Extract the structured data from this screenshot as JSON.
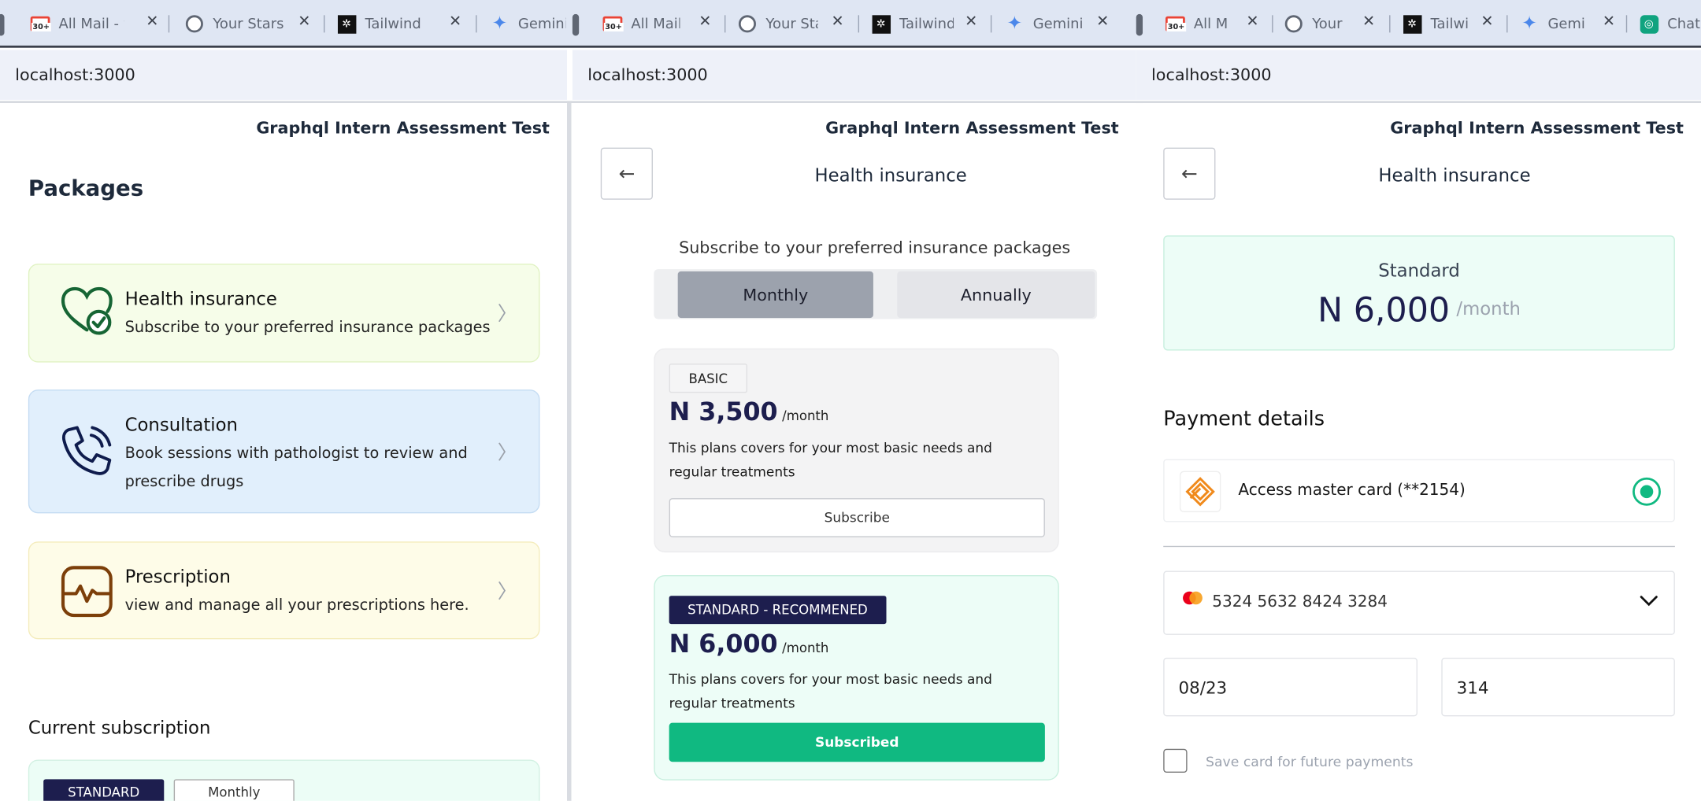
{
  "browser": {
    "tabs": [
      {
        "title": "All Mail - tu",
        "icon": "gmail-icon",
        "group": 1
      },
      {
        "title": "Your Stars",
        "icon": "github-icon",
        "group": 1
      },
      {
        "title": "Tailwind CS",
        "icon": "tailwind-icon",
        "group": 1
      },
      {
        "title": "Gemini",
        "icon": "gemini-icon",
        "group": 1
      },
      {
        "title": "All Mail",
        "icon": "gmail-icon",
        "group": 2
      },
      {
        "title": "Your Sta",
        "icon": "github-icon",
        "group": 2
      },
      {
        "title": "Tailwind",
        "icon": "tailwind-icon",
        "group": 2
      },
      {
        "title": "Gemini",
        "icon": "gemini-icon",
        "group": 2
      },
      {
        "title": "All M",
        "icon": "gmail-icon",
        "group": 3
      },
      {
        "title": "Your",
        "icon": "github-icon",
        "group": 3
      },
      {
        "title": "Tailwi",
        "icon": "tailwind-icon",
        "group": 3
      },
      {
        "title": "Gemi",
        "icon": "gemini-icon",
        "group": 3
      },
      {
        "title": "Chat",
        "icon": "chatgpt-icon",
        "group": 3
      }
    ],
    "gmail_badge": "30+",
    "url": "localhost:3000"
  },
  "site": {
    "header": "Graphql Intern Assessment Test"
  },
  "packages_page": {
    "title": "Packages",
    "cards": [
      {
        "title": "Health insurance",
        "desc": "Subscribe to your preferred insurance packages",
        "icon": "heart-check-icon"
      },
      {
        "title": "Consultation",
        "desc": "Book sessions with pathologist to review and prescribe drugs",
        "icon": "phone-call-icon"
      },
      {
        "title": "Prescription",
        "desc": "view and manage all your prescriptions here.",
        "icon": "heartbeat-monitor-icon"
      }
    ],
    "current_subscription": {
      "label": "Current subscription",
      "plan": "STANDARD",
      "period": "Monthly"
    }
  },
  "plans_page": {
    "title": "Health insurance",
    "subtitle": "Subscribe to your preferred insurance packages",
    "toggle": {
      "monthly": "Monthly",
      "annually": "Annually",
      "selected": "Monthly"
    },
    "plans": [
      {
        "tag": "BASIC",
        "price": "N 3,500",
        "per": "/month",
        "desc": "This plans covers for your most basic needs and regular treatments",
        "button": "Subscribe"
      },
      {
        "tag": "STANDARD - RECOMMENED",
        "price": "N 6,000",
        "per": "/month",
        "desc": "This plans covers for your most basic needs and regular treatments",
        "button": "Subscribed"
      }
    ]
  },
  "payment_page": {
    "title": "Health insurance",
    "plan_name": "Standard",
    "plan_price": "N 6,000",
    "plan_per": "/month",
    "payment_details_label": "Payment details",
    "account": "Access master card (**2154)",
    "card_number": "5324 5632 8424 3284",
    "expiry": "08/23",
    "cvv": "314",
    "save_card_label": "Save card for future payments"
  },
  "colors": {
    "accent": "#10b981",
    "navy": "#1d1e4e",
    "mint_bg": "#edfdf7"
  }
}
